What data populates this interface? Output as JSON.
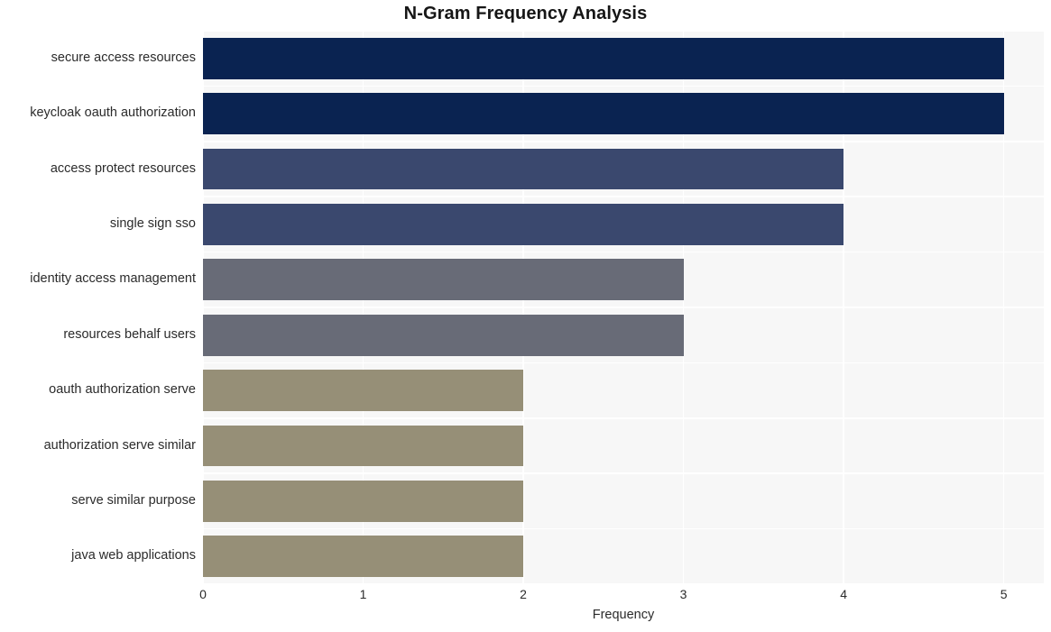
{
  "chart_data": {
    "type": "bar",
    "orientation": "horizontal",
    "title": "N-Gram Frequency Analysis",
    "xlabel": "Frequency",
    "ylabel": "",
    "categories": [
      "secure access resources",
      "keycloak oauth authorization",
      "access protect resources",
      "single sign sso",
      "identity access management",
      "resources behalf users",
      "oauth authorization serve",
      "authorization serve similar",
      "serve similar purpose",
      "java web applications"
    ],
    "values": [
      5,
      5,
      4,
      4,
      3,
      3,
      2,
      2,
      2,
      2
    ],
    "bar_colors": [
      "#0a2351",
      "#0a2351",
      "#3a486e",
      "#3a486e",
      "#686b77",
      "#686b77",
      "#968f77",
      "#968f77",
      "#968f77",
      "#968f77"
    ],
    "xlim": [
      0,
      5.25
    ],
    "xticks": [
      0,
      1,
      2,
      3,
      4,
      5
    ],
    "xtick_labels": [
      "0",
      "1",
      "2",
      "3",
      "4",
      "5"
    ],
    "grid": true,
    "grid_color": "#ffffff",
    "plot_background": "#f7f7f7",
    "figure_background": "#ffffff",
    "legend": null
  }
}
